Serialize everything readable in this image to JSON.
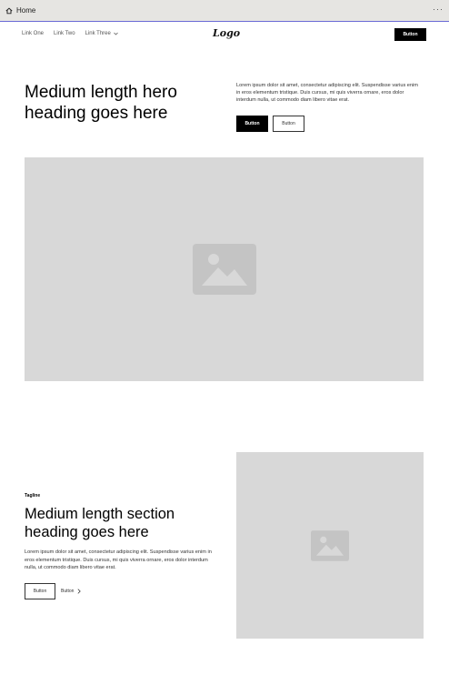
{
  "browser": {
    "tab_title": "Home",
    "more_label": "···"
  },
  "nav": {
    "links": [
      "Link One",
      "Link Two",
      "Link Three"
    ],
    "logo": "Logo",
    "button_label": "Button"
  },
  "hero": {
    "heading": "Medium length hero heading goes here",
    "body": "Lorem ipsum dolor sit amet, consectetur adipiscing elit. Suspendisse varius enim in eros elementum tristique. Duis cursus, mi quis viverra ornare, eros dolor interdum nulla, ut commodo diam libero vitae erat.",
    "primary_button": "Button",
    "secondary_button": "Button",
    "image_icon": "image-placeholder-icon"
  },
  "section": {
    "tagline": "Tagline",
    "heading": "Medium length section heading goes here",
    "body": "Lorem ipsum dolor sit amet, consectetur adipiscing elit. Suspendisse varius enim in eros elementum tristique. Duis cursus, mi quis viverra ornare, eros dolor interdum nulla, ut commodo diam libero vitae erat.",
    "outline_button": "Button",
    "link_button": "Button",
    "image_icon": "image-placeholder-icon"
  },
  "colors": {
    "accent_line": "#6b6bd6",
    "placeholder_bg": "#d8d8d8",
    "placeholder_icon": "#bfbfbf"
  }
}
